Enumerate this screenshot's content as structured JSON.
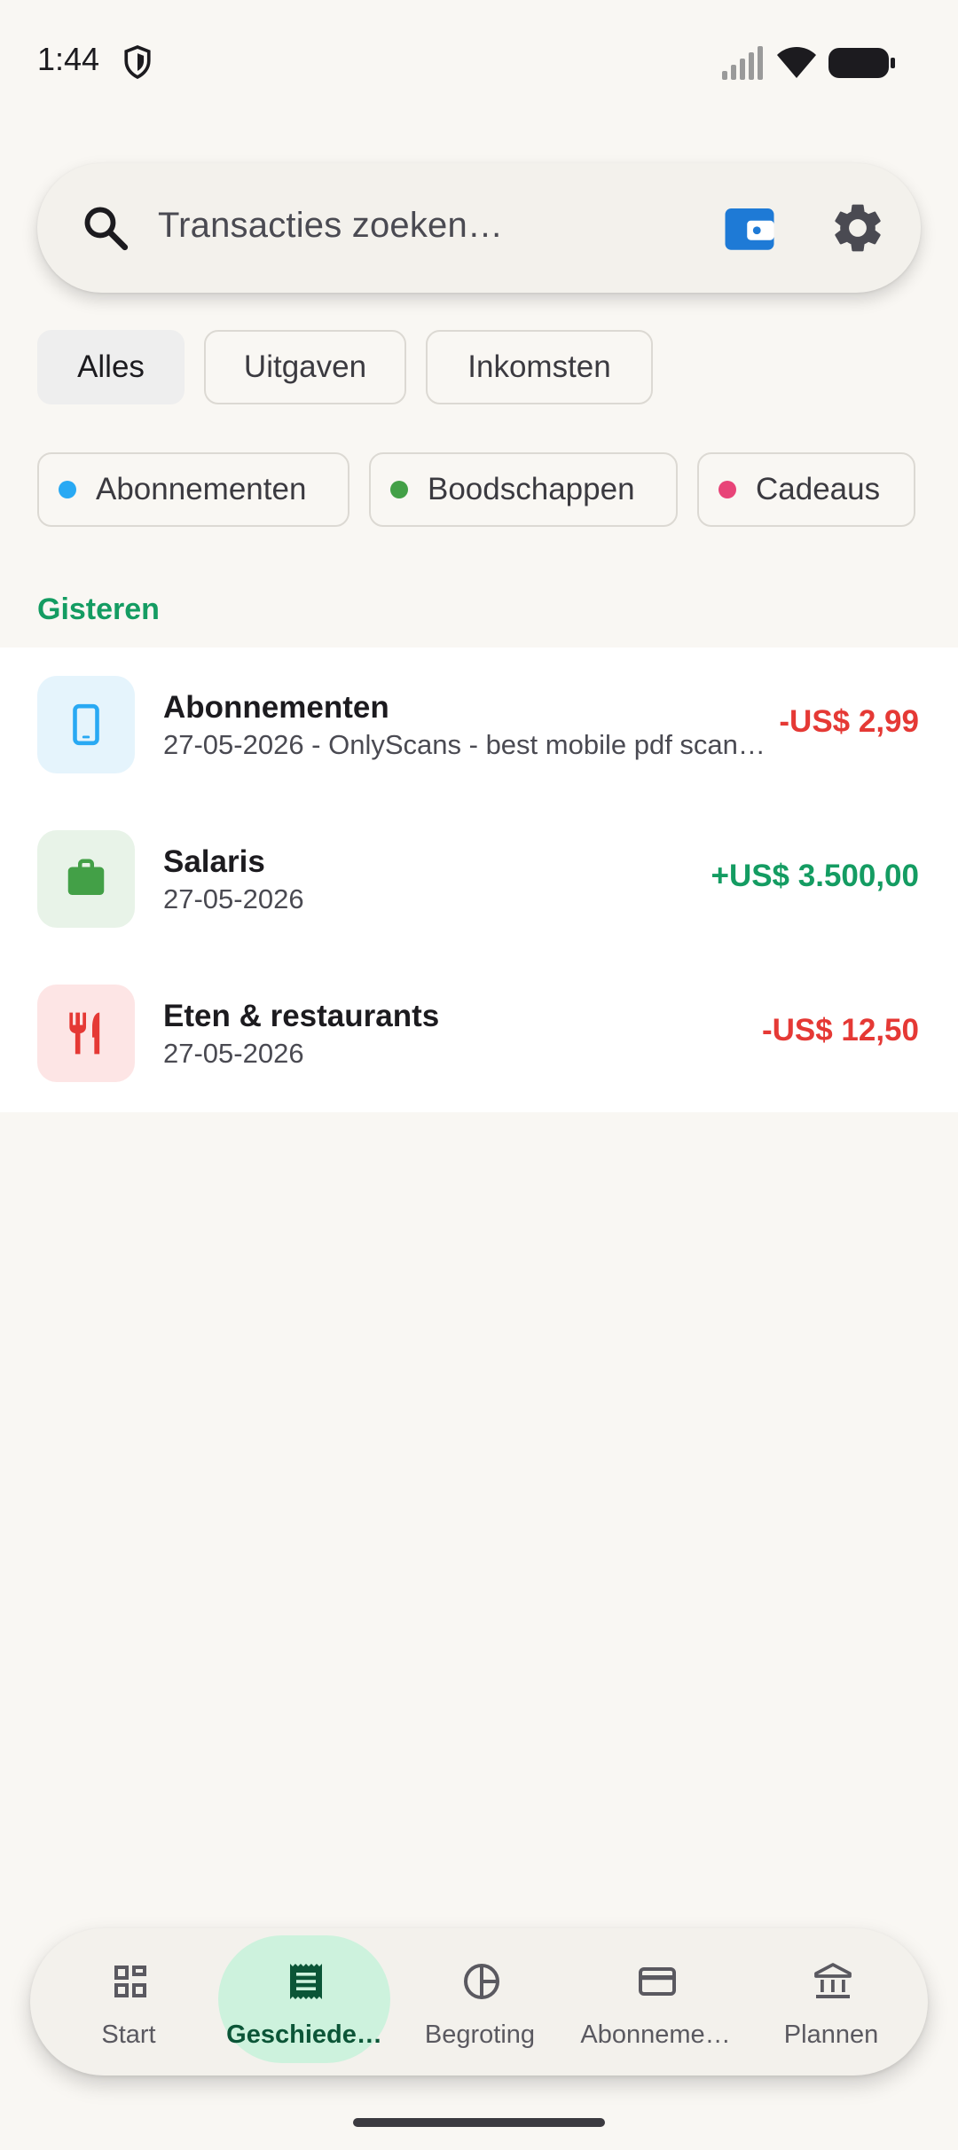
{
  "status_bar": {
    "time": "1:44"
  },
  "search": {
    "placeholder": "Transacties zoeken…"
  },
  "filters": [
    "Alles",
    "Uitgaven",
    "Inkomsten"
  ],
  "categories": [
    {
      "label": "Abonnementen",
      "color": "#29a9f3"
    },
    {
      "label": "Boodschappen",
      "color": "#43a047"
    },
    {
      "label": "Cadeaus",
      "color": "#e84478"
    }
  ],
  "section": {
    "title": "Gisteren"
  },
  "transactions": [
    {
      "title": "Abonnementen",
      "subtitle": "27-05-2026 - OnlyScans - best mobile pdf scanner",
      "amount": "-US$ 2,99",
      "icon": "smartphone-icon",
      "icon_bg": "#e5f4fc",
      "icon_color": "#29a9f3"
    },
    {
      "title": "Salaris",
      "subtitle": "27-05-2026",
      "amount": "+US$ 3.500,00",
      "icon": "briefcase-icon",
      "icon_bg": "#e8f3e8",
      "icon_color": "#43a047"
    },
    {
      "title": "Eten & restaurants",
      "subtitle": "27-05-2026",
      "amount": "-US$ 12,50",
      "icon": "fork-knife-icon",
      "icon_bg": "#fde5e5",
      "icon_color": "#e53935"
    }
  ],
  "nav": [
    {
      "label": "Start",
      "icon": "dashboard-icon"
    },
    {
      "label": "Geschiede…",
      "icon": "receipt-icon",
      "active": true
    },
    {
      "label": "Begroting",
      "icon": "pie-chart-icon"
    },
    {
      "label": "Abonneme…",
      "icon": "credit-card-icon"
    },
    {
      "label": "Plannen",
      "icon": "bank-icon"
    }
  ]
}
